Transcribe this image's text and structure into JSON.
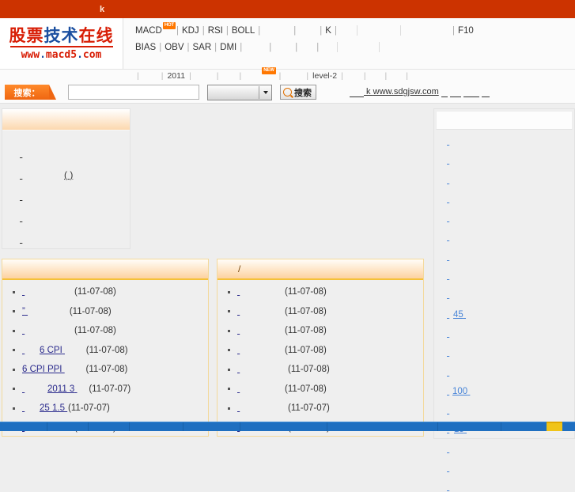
{
  "topbar": {
    "text": "k"
  },
  "logo": {
    "line1": [
      {
        "t": "股",
        "c": "r"
      },
      {
        "t": "票",
        "c": "r"
      },
      {
        "t": "技",
        "c": "b"
      },
      {
        "t": "术",
        "c": "b"
      },
      {
        "t": "在",
        "c": "r"
      },
      {
        "t": "线",
        "c": "r"
      }
    ],
    "url_parts": [
      {
        "t": "www",
        "c": "r"
      },
      {
        "t": ".",
        "c": "b"
      },
      {
        "t": "macd5",
        "c": "r"
      },
      {
        "t": ".",
        "c": "b"
      },
      {
        "t": "com",
        "c": "r"
      }
    ],
    "alt": "股票技术在线 www.macd5.com"
  },
  "nav": {
    "row1": [
      {
        "label": "MACD",
        "badge": "HOT"
      },
      {
        "label": "KDJ"
      },
      {
        "label": "RSI"
      },
      {
        "label": "BOLL"
      },
      {
        "label": "",
        "blank": 34
      },
      {
        "label": "",
        "blank": 22
      },
      {
        "label": "K"
      },
      {
        "label": "",
        "blank": 10
      },
      {
        "rule": true
      },
      {
        "label": "",
        "blank": 32
      },
      {
        "rule": true
      },
      {
        "label": "",
        "blank": 50
      },
      {
        "label": "F10"
      }
    ],
    "row2": [
      {
        "label": "BIAS"
      },
      {
        "label": "OBV"
      },
      {
        "label": "SAR"
      },
      {
        "label": "DMI"
      },
      {
        "label": "",
        "blank": 26
      },
      {
        "label": "",
        "blank": 22
      },
      {
        "label": "",
        "blank": 16
      },
      {
        "label": "",
        "blank": 8
      },
      {
        "rule": true
      },
      {
        "label": "",
        "blank": 30
      },
      {
        "rule": true
      }
    ]
  },
  "subnav": [
    {
      "label": "",
      "blank": 18
    },
    {
      "label": "2011"
    },
    {
      "label": "",
      "blank": 22
    },
    {
      "label": "",
      "blank": 16
    },
    {
      "label": "",
      "blank": 22,
      "badge": "NEW"
    },
    {
      "label": "",
      "blank": 22
    },
    {
      "label": "level-2"
    },
    {
      "label": "",
      "blank": 16
    },
    {
      "label": "",
      "blank": 14
    },
    {
      "label": "",
      "blank": 14
    }
  ],
  "search": {
    "tag_label": "搜索：",
    "input_value": "",
    "input_placeholder": "",
    "select_value": "",
    "button_label": "搜索",
    "button_icon": "search-icon",
    "hotline_prefix_blank": 18,
    "hotline_k": "k",
    "hotline_site": "www.sdgjsw.com",
    "hotline_tail_blanks": [
      8,
      14,
      20,
      10
    ]
  },
  "sidebar": {
    "header_title": "",
    "items": [
      {
        "label": "",
        "blank": 56,
        "suffix": ""
      },
      {
        "label": "",
        "blank": 56,
        "suffix": "( )"
      },
      {
        "label": "",
        "blank": 58,
        "suffix": ""
      },
      {
        "label": "",
        "blank": 58,
        "suffix": ""
      },
      {
        "label": "",
        "blank": 58,
        "suffix": ""
      },
      {
        "label": "",
        "blank": 58,
        "suffix": ""
      },
      {
        "label": "",
        "blank": 56,
        "suffix": ""
      }
    ]
  },
  "panels": [
    {
      "title": "",
      "items": [
        {
          "text": "",
          "blank": 66,
          "date": "(11-07-08)"
        },
        {
          "text": "”",
          "blank": 56,
          "date": "(11-07-08)"
        },
        {
          "text": "",
          "blank": 66,
          "date": "(11-07-08)"
        },
        {
          "text": "6 CPI",
          "blank": 0,
          "lead": 22,
          "trail": 30,
          "date": "(11-07-08)"
        },
        {
          "text": "6  CPI PPI",
          "blank": 0,
          "lead": 0,
          "trail": 30,
          "date": "(11-07-08)"
        },
        {
          "text": "2011 3",
          "blank": 0,
          "lead": 32,
          "trail": 18,
          "date": "(11-07-07)"
        },
        {
          "text": "25    1.5",
          "blank": 0,
          "lead": 22,
          "trail": 4,
          "date": "(11-07-07)"
        },
        {
          "text": "",
          "blank": 66,
          "date": "(11-07-07)"
        }
      ]
    },
    {
      "title": "/",
      "items": [
        {
          "text": "",
          "blank": 60,
          "date": "(11-07-08)"
        },
        {
          "text": "",
          "blank": 60,
          "date": "(11-07-08)"
        },
        {
          "text": "",
          "blank": 60,
          "date": "(11-07-08)"
        },
        {
          "text": "",
          "blank": 60,
          "date": "(11-07-08)"
        },
        {
          "text": "",
          "blank": 64,
          "date": "(11-07-08)"
        },
        {
          "text": "",
          "blank": 60,
          "date": "(11-07-08)"
        },
        {
          "text": "",
          "blank": 64,
          "date": "(11-07-07)"
        },
        {
          "text": "",
          "blank": 64,
          "date": "(11-07-07)"
        }
      ]
    }
  ],
  "right_panel": {
    "header_title": "",
    "items": [
      {
        "label": "",
        "blank": 16
      },
      {
        "label": "",
        "blank": 24
      },
      {
        "label": "",
        "blank": 15
      },
      {
        "label": "",
        "blank": 25
      },
      {
        "label": "",
        "blank": 16
      },
      {
        "label": "",
        "blank": 24
      },
      {
        "label": "",
        "blank": 20
      },
      {
        "label": "",
        "blank": 17
      },
      {
        "label": "",
        "blank": 18
      },
      {
        "label": "45",
        "blank": 8,
        "trail": 6
      },
      {
        "label": "",
        "blank": 14
      },
      {
        "label": "",
        "blank": 18
      },
      {
        "label": "",
        "blank": 14
      },
      {
        "label": "100",
        "blank": 7,
        "trail": 6
      },
      {
        "label": "",
        "blank": 14
      },
      {
        "label": "15",
        "blank": 9,
        "trail": 7
      },
      {
        "label": "",
        "blank": 20
      },
      {
        "label": "",
        "blank": 15
      },
      {
        "label": "",
        "blank": 16
      }
    ]
  },
  "colors": {
    "topbar": "#cc3300",
    "accent_orange": "#ff7700",
    "panel_border": "#f3d99b",
    "header_gold": "#f5c138",
    "link_blue": "#4a86d8",
    "news_link": "#2a2a8c",
    "taskbar_blue": "#1f6fc0",
    "logo_red": "#d81e06",
    "logo_blue": "#1b4fa0"
  }
}
